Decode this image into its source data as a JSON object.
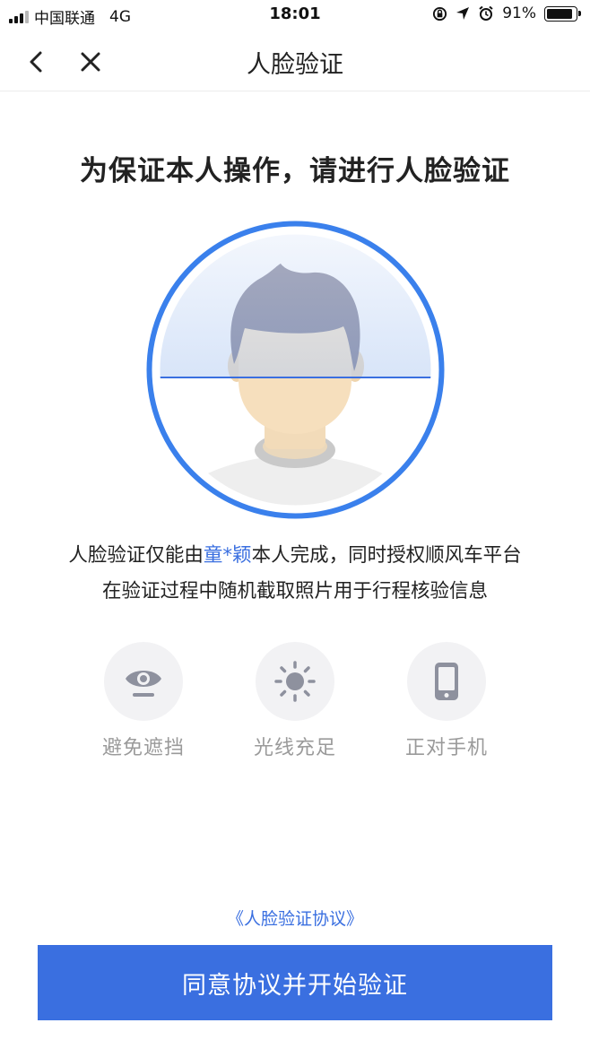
{
  "status_bar": {
    "carrier": "中国联通",
    "network": "4G",
    "time": "18:01",
    "battery": "91%"
  },
  "nav": {
    "title": "人脸验证",
    "back_icon": "chevron-left-icon",
    "close_icon": "close-icon"
  },
  "headline": "为保证本人操作，请进行人脸验证",
  "notice": {
    "prefix": "人脸验证仅能由",
    "name": "童*颖",
    "suffix": "本人完成，同时授权顺风车平台",
    "line2": "在验证过程中随机截取照片用于行程核验信息"
  },
  "tips": [
    {
      "icon": "eye-icon",
      "label": "避免遮挡"
    },
    {
      "icon": "sun-icon",
      "label": "光线充足"
    },
    {
      "icon": "phone-icon",
      "label": "正对手机"
    }
  ],
  "agreement_link": "《人脸验证协议》",
  "start_button": "同意协议并开始验证",
  "colors": {
    "accent": "#3a6fe0",
    "tip_icon": "#8e919e",
    "tip_bg": "#f2f2f4"
  }
}
